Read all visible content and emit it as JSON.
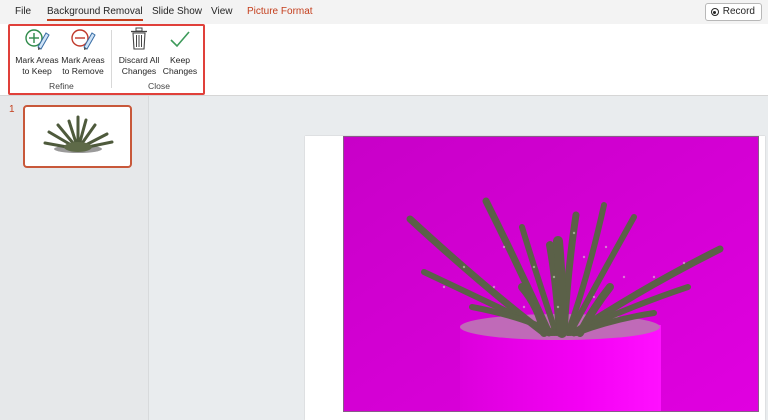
{
  "menu": {
    "file": "File",
    "background_removal": "Background Removal",
    "slide_show": "Slide Show",
    "view": "View",
    "picture_format": "Picture Format"
  },
  "record": {
    "label": "Record",
    "icon": "record-icon"
  },
  "ribbon": {
    "refine": {
      "label": "Refine",
      "mark_keep": {
        "line1": "Mark Areas",
        "line2": "to Keep",
        "icon": "pencil-plus-icon"
      },
      "mark_remove": {
        "line1": "Mark Areas",
        "line2": "to Remove",
        "icon": "pencil-minus-icon"
      }
    },
    "close": {
      "label": "Close",
      "discard": {
        "line1": "Discard All",
        "line2": "Changes",
        "icon": "trash-icon"
      },
      "keep": {
        "line1": "Keep",
        "line2": "Changes",
        "icon": "checkmark-icon"
      }
    }
  },
  "slides": {
    "current_number": "1"
  },
  "colors": {
    "accent": "#c43e1c",
    "removal_mask": "#d400d4",
    "highlight": "#e0403a"
  }
}
